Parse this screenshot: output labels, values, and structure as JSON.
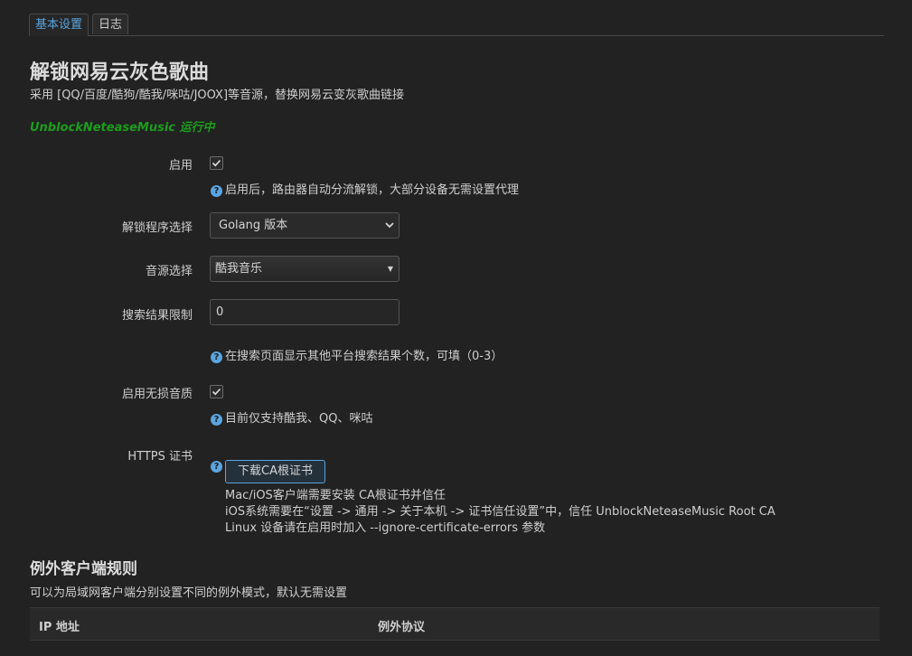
{
  "tabs": [
    {
      "label": "基本设置",
      "active": true
    },
    {
      "label": "日志",
      "active": false
    }
  ],
  "header": {
    "title": "解锁网易云灰色歌曲",
    "subtitle": "采用 [QQ/百度/酷狗/酷我/咪咕/JOOX]等音源，替换网易云变灰歌曲链接",
    "status": "UnblockNeteaseMusic 运行中"
  },
  "form": {
    "enable": {
      "label": "启用",
      "checked": true,
      "help": "启用后，路由器自动分流解锁，大部分设备无需设置代理"
    },
    "program": {
      "label": "解锁程序选择",
      "value": "Golang 版本"
    },
    "source": {
      "label": "音源选择",
      "value": "酷我音乐"
    },
    "search_limit": {
      "label": "搜索结果限制",
      "value": "0",
      "help": "在搜索页面显示其他平台搜索结果个数，可填（0-3）"
    },
    "lossless": {
      "label": "启用无损音质",
      "checked": true,
      "help": "目前仅支持酷我、QQ、咪咕"
    },
    "https_cert": {
      "label": "HTTPS 证书",
      "button": "下载CA根证书",
      "lines": [
        "Mac/iOS客户端需要安装 CA根证书并信任",
        "iOS系统需要在“设置 -> 通用 -> 关于本机 -> 证书信任设置”中，信任 UnblockNeteaseMusic Root CA",
        "Linux 设备请在启用时加入 --ignore-certificate-errors 参数"
      ]
    }
  },
  "exceptions": {
    "title": "例外客户端规则",
    "description": "可以为局域网客户端分别设置不同的例外模式，默认无需设置",
    "columns": [
      "IP 地址",
      "例外协议"
    ]
  },
  "colors": {
    "accent": "#5aa5e0",
    "status_green": "#1b9e1b",
    "background": "#222222"
  },
  "icons": {
    "help": "question-circle-icon",
    "check": "checkmark-icon",
    "dropdown": "chevron-down-icon"
  }
}
